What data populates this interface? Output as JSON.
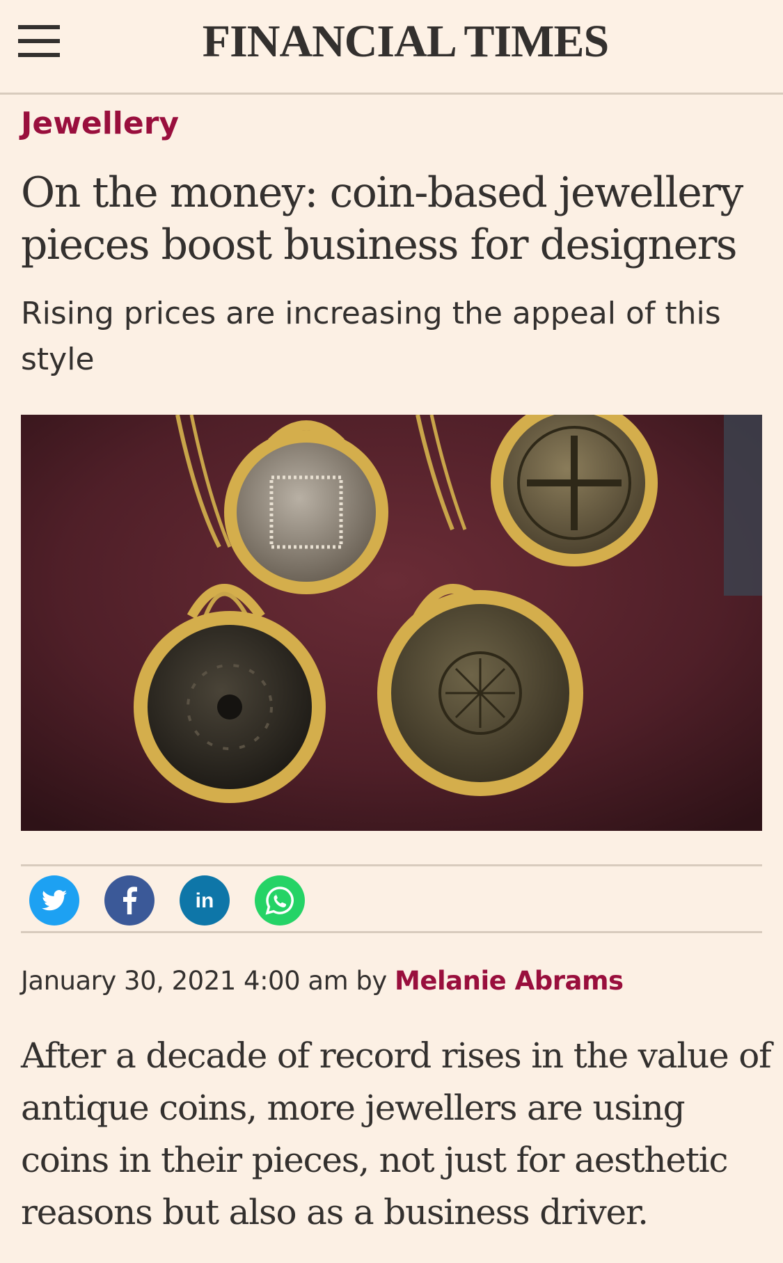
{
  "header": {
    "brand": "FINANCIAL TIMES",
    "menu_icon": "hamburger-menu-icon"
  },
  "article": {
    "section": "Jewellery",
    "headline": "On the money: coin-based jewellery pieces boost business for designers",
    "standfirst": "Rising prices are increasing the appeal of this style",
    "date": "January 30, 2021 4:00 am",
    "by": "by",
    "author": "Melanie Abrams",
    "body": "After a decade of record rises in the value of antique coins, more jewellers are using coins in their pieces, not just for aesthetic reasons but also as a business driver."
  },
  "share": [
    {
      "icon": "twitter-icon",
      "color": "#1da1f2"
    },
    {
      "icon": "facebook-icon",
      "color": "#3b5998"
    },
    {
      "icon": "linkedin-icon",
      "color": "#0e76a8"
    },
    {
      "icon": "whatsapp-icon",
      "color": "#25d366"
    }
  ],
  "colors": {
    "background": "#fcf0e4",
    "accent": "#990f3d",
    "text": "#33302e"
  }
}
